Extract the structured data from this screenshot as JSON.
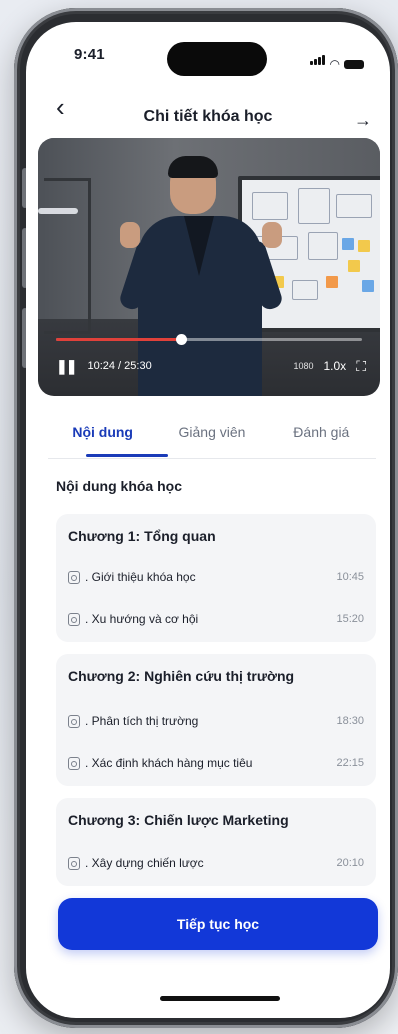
{
  "status_bar": {
    "time": "9:41"
  },
  "header": {
    "title": "Chi tiết khóa học",
    "back_icon": "chevron-left-icon",
    "share_icon": "arrow-right-icon"
  },
  "video": {
    "time_label": "10:24 / 25:30",
    "progress": 0.41,
    "quality": "1080",
    "speed": "1.0x"
  },
  "tabs": [
    {
      "label": "Nội dung",
      "active": true
    },
    {
      "label": "Giảng viên",
      "active": false
    },
    {
      "label": "Đánh giá",
      "active": false
    }
  ],
  "content": {
    "section_title": "Nội dung khóa học",
    "chapters": [
      {
        "title": "Chương 1: Tổng quan",
        "lessons": [
          {
            "label": ". Giới thiệu khóa học",
            "duration": "10:45"
          },
          {
            "label": ". Xu hướng và cơ hội",
            "duration": "15:20"
          }
        ]
      },
      {
        "title": "Chương 2: Nghiên cứu thị trường",
        "lessons": [
          {
            "label": ". Phân tích thị trường",
            "duration": "18:30"
          },
          {
            "label": ". Xác định khách hàng mục tiêu",
            "duration": "22:15"
          }
        ]
      },
      {
        "title": "Chương 3: Chiến lược Marketing",
        "lessons": [
          {
            "label": ". Xây dựng chiến lược",
            "duration": "20:10"
          }
        ]
      }
    ]
  },
  "cta": {
    "label": "Tiếp tục học"
  },
  "colors": {
    "accent": "#1238d8",
    "progress": "#e0413a"
  }
}
